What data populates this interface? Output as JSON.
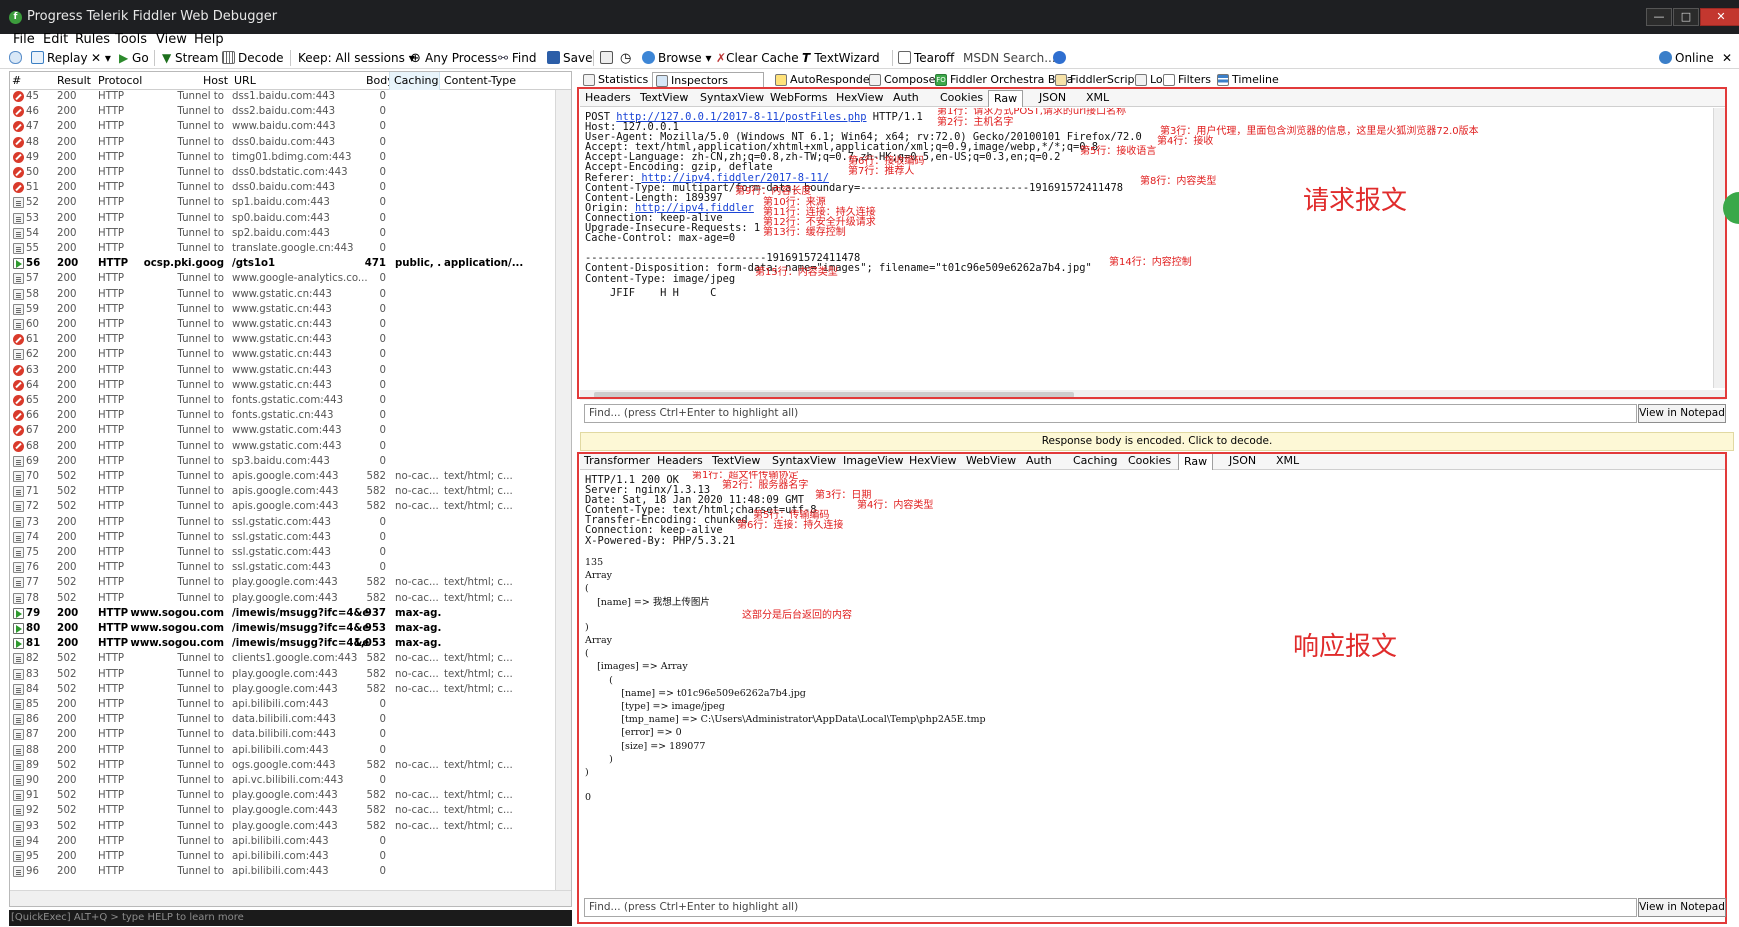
{
  "window": {
    "title": "Progress Telerik Fiddler Web Debugger",
    "controls": {
      "minimize": "—",
      "maximize": "□",
      "close": "✕"
    }
  },
  "menu": [
    "File",
    "Edit",
    "Rules",
    "Tools",
    "View",
    "Help"
  ],
  "toolbar": {
    "replay": "Replay",
    "remove": "✕ ▾",
    "go": "Go",
    "stream": "Stream",
    "decode": "Decode",
    "keep": "Keep: All sessions ▾",
    "any_process": "Any Process",
    "find": "Find",
    "save": "Save",
    "browse": "Browse ▾",
    "clear_cache": "Clear Cache",
    "textwizard": "TextWizard",
    "tearoff": "Tearoff",
    "msdn_search": "MSDN Search...",
    "online": "Online"
  },
  "sessions": {
    "columns": [
      "#",
      "Result",
      "Protocol",
      "Host",
      "URL",
      "Body",
      "Caching",
      "Content-Type"
    ],
    "rows": [
      {
        "id": "45",
        "icon": "blocked",
        "result": "200",
        "protocol": "HTTP",
        "host": "Tunnel to",
        "url": "dss1.baidu.com:443",
        "body": "0",
        "caching": "",
        "ctype": ""
      },
      {
        "id": "46",
        "icon": "blocked",
        "result": "200",
        "protocol": "HTTP",
        "host": "Tunnel to",
        "url": "dss2.baidu.com:443",
        "body": "0",
        "caching": "",
        "ctype": ""
      },
      {
        "id": "47",
        "icon": "blocked",
        "result": "200",
        "protocol": "HTTP",
        "host": "Tunnel to",
        "url": "www.baidu.com:443",
        "body": "0",
        "caching": "",
        "ctype": ""
      },
      {
        "id": "48",
        "icon": "blocked",
        "result": "200",
        "protocol": "HTTP",
        "host": "Tunnel to",
        "url": "dss0.baidu.com:443",
        "body": "0",
        "caching": "",
        "ctype": ""
      },
      {
        "id": "49",
        "icon": "blocked",
        "result": "200",
        "protocol": "HTTP",
        "host": "Tunnel to",
        "url": "timg01.bdimg.com:443",
        "body": "0",
        "caching": "",
        "ctype": ""
      },
      {
        "id": "50",
        "icon": "blocked",
        "result": "200",
        "protocol": "HTTP",
        "host": "Tunnel to",
        "url": "dss0.bdstatic.com:443",
        "body": "0",
        "caching": "",
        "ctype": ""
      },
      {
        "id": "51",
        "icon": "blocked",
        "result": "200",
        "protocol": "HTTP",
        "host": "Tunnel to",
        "url": "dss0.baidu.com:443",
        "body": "0",
        "caching": "",
        "ctype": ""
      },
      {
        "id": "52",
        "icon": "tunnel",
        "result": "200",
        "protocol": "HTTP",
        "host": "Tunnel to",
        "url": "sp1.baidu.com:443",
        "body": "0",
        "caching": "",
        "ctype": ""
      },
      {
        "id": "53",
        "icon": "tunnel",
        "result": "200",
        "protocol": "HTTP",
        "host": "Tunnel to",
        "url": "sp0.baidu.com:443",
        "body": "0",
        "caching": "",
        "ctype": ""
      },
      {
        "id": "54",
        "icon": "tunnel",
        "result": "200",
        "protocol": "HTTP",
        "host": "Tunnel to",
        "url": "sp2.baidu.com:443",
        "body": "0",
        "caching": "",
        "ctype": ""
      },
      {
        "id": "55",
        "icon": "tunnel",
        "result": "200",
        "protocol": "HTTP",
        "host": "Tunnel to",
        "url": "translate.google.cn:443",
        "body": "0",
        "caching": "",
        "ctype": ""
      },
      {
        "id": "56",
        "icon": "arrow",
        "bold": true,
        "result": "200",
        "protocol": "HTTP",
        "host": "ocsp.pki.goog",
        "url": "/gts1o1",
        "body": "471",
        "caching": "public, ...",
        "ctype": "application/..."
      },
      {
        "id": "57",
        "icon": "tunnel",
        "result": "200",
        "protocol": "HTTP",
        "host": "Tunnel to",
        "url": "www.google-analytics.co...",
        "body": "0",
        "caching": "",
        "ctype": ""
      },
      {
        "id": "58",
        "icon": "tunnel",
        "result": "200",
        "protocol": "HTTP",
        "host": "Tunnel to",
        "url": "www.gstatic.cn:443",
        "body": "0",
        "caching": "",
        "ctype": ""
      },
      {
        "id": "59",
        "icon": "tunnel",
        "result": "200",
        "protocol": "HTTP",
        "host": "Tunnel to",
        "url": "www.gstatic.cn:443",
        "body": "0",
        "caching": "",
        "ctype": ""
      },
      {
        "id": "60",
        "icon": "tunnel",
        "result": "200",
        "protocol": "HTTP",
        "host": "Tunnel to",
        "url": "www.gstatic.cn:443",
        "body": "0",
        "caching": "",
        "ctype": ""
      },
      {
        "id": "61",
        "icon": "blocked",
        "result": "200",
        "protocol": "HTTP",
        "host": "Tunnel to",
        "url": "www.gstatic.cn:443",
        "body": "0",
        "caching": "",
        "ctype": ""
      },
      {
        "id": "62",
        "icon": "tunnel",
        "result": "200",
        "protocol": "HTTP",
        "host": "Tunnel to",
        "url": "www.gstatic.cn:443",
        "body": "0",
        "caching": "",
        "ctype": ""
      },
      {
        "id": "63",
        "icon": "blocked",
        "result": "200",
        "protocol": "HTTP",
        "host": "Tunnel to",
        "url": "www.gstatic.cn:443",
        "body": "0",
        "caching": "",
        "ctype": ""
      },
      {
        "id": "64",
        "icon": "blocked",
        "result": "200",
        "protocol": "HTTP",
        "host": "Tunnel to",
        "url": "www.gstatic.cn:443",
        "body": "0",
        "caching": "",
        "ctype": ""
      },
      {
        "id": "65",
        "icon": "blocked",
        "result": "200",
        "protocol": "HTTP",
        "host": "Tunnel to",
        "url": "fonts.gstatic.com:443",
        "body": "0",
        "caching": "",
        "ctype": ""
      },
      {
        "id": "66",
        "icon": "blocked",
        "result": "200",
        "protocol": "HTTP",
        "host": "Tunnel to",
        "url": "fonts.gstatic.cn:443",
        "body": "0",
        "caching": "",
        "ctype": ""
      },
      {
        "id": "67",
        "icon": "blocked",
        "result": "200",
        "protocol": "HTTP",
        "host": "Tunnel to",
        "url": "www.gstatic.com:443",
        "body": "0",
        "caching": "",
        "ctype": ""
      },
      {
        "id": "68",
        "icon": "blocked",
        "result": "200",
        "protocol": "HTTP",
        "host": "Tunnel to",
        "url": "www.gstatic.com:443",
        "body": "0",
        "caching": "",
        "ctype": ""
      },
      {
        "id": "69",
        "icon": "tunnel",
        "result": "200",
        "protocol": "HTTP",
        "host": "Tunnel to",
        "url": "sp3.baidu.com:443",
        "body": "0",
        "caching": "",
        "ctype": ""
      },
      {
        "id": "70",
        "icon": "tunnel",
        "result": "502",
        "protocol": "HTTP",
        "host": "Tunnel to",
        "url": "apis.google.com:443",
        "body": "582",
        "caching": "no-cac...",
        "ctype": "text/html; c..."
      },
      {
        "id": "71",
        "icon": "tunnel",
        "result": "502",
        "protocol": "HTTP",
        "host": "Tunnel to",
        "url": "apis.google.com:443",
        "body": "582",
        "caching": "no-cac...",
        "ctype": "text/html; c..."
      },
      {
        "id": "72",
        "icon": "tunnel",
        "result": "502",
        "protocol": "HTTP",
        "host": "Tunnel to",
        "url": "apis.google.com:443",
        "body": "582",
        "caching": "no-cac...",
        "ctype": "text/html; c..."
      },
      {
        "id": "73",
        "icon": "tunnel",
        "result": "200",
        "protocol": "HTTP",
        "host": "Tunnel to",
        "url": "ssl.gstatic.com:443",
        "body": "0",
        "caching": "",
        "ctype": ""
      },
      {
        "id": "74",
        "icon": "tunnel",
        "result": "200",
        "protocol": "HTTP",
        "host": "Tunnel to",
        "url": "ssl.gstatic.com:443",
        "body": "0",
        "caching": "",
        "ctype": ""
      },
      {
        "id": "75",
        "icon": "tunnel",
        "result": "200",
        "protocol": "HTTP",
        "host": "Tunnel to",
        "url": "ssl.gstatic.com:443",
        "body": "0",
        "caching": "",
        "ctype": ""
      },
      {
        "id": "76",
        "icon": "tunnel",
        "result": "200",
        "protocol": "HTTP",
        "host": "Tunnel to",
        "url": "ssl.gstatic.com:443",
        "body": "0",
        "caching": "",
        "ctype": ""
      },
      {
        "id": "77",
        "icon": "tunnel",
        "result": "502",
        "protocol": "HTTP",
        "host": "Tunnel to",
        "url": "play.google.com:443",
        "body": "582",
        "caching": "no-cac...",
        "ctype": "text/html; c..."
      },
      {
        "id": "78",
        "icon": "tunnel",
        "result": "502",
        "protocol": "HTTP",
        "host": "Tunnel to",
        "url": "play.google.com:443",
        "body": "582",
        "caching": "no-cac...",
        "ctype": "text/html; c..."
      },
      {
        "id": "79",
        "icon": "arrow",
        "bold": true,
        "result": "200",
        "protocol": "HTTP",
        "host": "www.sogou.com",
        "url": "/imewis/msugg?ifc=4&em=4",
        "body": "937",
        "caching": "max-ag...",
        "ctype": ""
      },
      {
        "id": "80",
        "icon": "arrow",
        "bold": true,
        "result": "200",
        "protocol": "HTTP",
        "host": "www.sogou.com",
        "url": "/imewis/msugg?ifc=4&em=4",
        "body": "953",
        "caching": "max-ag...",
        "ctype": ""
      },
      {
        "id": "81",
        "icon": "arrow",
        "bold": true,
        "result": "200",
        "protocol": "HTTP",
        "host": "www.sogou.com",
        "url": "/imewis/msugg?ifc=4&em=4",
        "body": "1,053",
        "caching": "max-ag...",
        "ctype": ""
      },
      {
        "id": "82",
        "icon": "tunnel",
        "result": "502",
        "protocol": "HTTP",
        "host": "Tunnel to",
        "url": "clients1.google.com:443",
        "body": "582",
        "caching": "no-cac...",
        "ctype": "text/html; c..."
      },
      {
        "id": "83",
        "icon": "tunnel",
        "result": "502",
        "protocol": "HTTP",
        "host": "Tunnel to",
        "url": "play.google.com:443",
        "body": "582",
        "caching": "no-cac...",
        "ctype": "text/html; c..."
      },
      {
        "id": "84",
        "icon": "tunnel",
        "result": "502",
        "protocol": "HTTP",
        "host": "Tunnel to",
        "url": "play.google.com:443",
        "body": "582",
        "caching": "no-cac...",
        "ctype": "text/html; c..."
      },
      {
        "id": "85",
        "icon": "tunnel",
        "result": "200",
        "protocol": "HTTP",
        "host": "Tunnel to",
        "url": "api.bilibili.com:443",
        "body": "0",
        "caching": "",
        "ctype": ""
      },
      {
        "id": "86",
        "icon": "tunnel",
        "result": "200",
        "protocol": "HTTP",
        "host": "Tunnel to",
        "url": "data.bilibili.com:443",
        "body": "0",
        "caching": "",
        "ctype": ""
      },
      {
        "id": "87",
        "icon": "tunnel",
        "result": "200",
        "protocol": "HTTP",
        "host": "Tunnel to",
        "url": "data.bilibili.com:443",
        "body": "0",
        "caching": "",
        "ctype": ""
      },
      {
        "id": "88",
        "icon": "tunnel",
        "result": "200",
        "protocol": "HTTP",
        "host": "Tunnel to",
        "url": "api.bilibili.com:443",
        "body": "0",
        "caching": "",
        "ctype": ""
      },
      {
        "id": "89",
        "icon": "tunnel",
        "result": "502",
        "protocol": "HTTP",
        "host": "Tunnel to",
        "url": "ogs.google.com:443",
        "body": "582",
        "caching": "no-cac...",
        "ctype": "text/html; c..."
      },
      {
        "id": "90",
        "icon": "tunnel",
        "result": "200",
        "protocol": "HTTP",
        "host": "Tunnel to",
        "url": "api.vc.bilibili.com:443",
        "body": "0",
        "caching": "",
        "ctype": ""
      },
      {
        "id": "91",
        "icon": "tunnel",
        "result": "502",
        "protocol": "HTTP",
        "host": "Tunnel to",
        "url": "play.google.com:443",
        "body": "582",
        "caching": "no-cac...",
        "ctype": "text/html; c..."
      },
      {
        "id": "92",
        "icon": "tunnel",
        "result": "502",
        "protocol": "HTTP",
        "host": "Tunnel to",
        "url": "play.google.com:443",
        "body": "582",
        "caching": "no-cac...",
        "ctype": "text/html; c..."
      },
      {
        "id": "93",
        "icon": "tunnel",
        "result": "502",
        "protocol": "HTTP",
        "host": "Tunnel to",
        "url": "play.google.com:443",
        "body": "582",
        "caching": "no-cac...",
        "ctype": "text/html; c..."
      },
      {
        "id": "94",
        "icon": "tunnel",
        "result": "200",
        "protocol": "HTTP",
        "host": "Tunnel to",
        "url": "api.bilibili.com:443",
        "body": "0",
        "caching": "",
        "ctype": ""
      },
      {
        "id": "95",
        "icon": "tunnel",
        "result": "200",
        "protocol": "HTTP",
        "host": "Tunnel to",
        "url": "api.bilibili.com:443",
        "body": "0",
        "caching": "",
        "ctype": ""
      },
      {
        "id": "96",
        "icon": "tunnel",
        "result": "200",
        "protocol": "HTTP",
        "host": "Tunnel to",
        "url": "api.bilibili.com:443",
        "body": "0",
        "caching": "",
        "ctype": ""
      }
    ]
  },
  "quickexec": "[QuickExec] ALT+Q > type HELP to learn more",
  "main_tabs": [
    "Statistics",
    "Inspectors",
    "AutoResponder",
    "Composer",
    "Fiddler Orchestra Beta",
    "FiddlerScript",
    "Log",
    "Filters",
    "Timeline"
  ],
  "fo_badge": "FO",
  "request": {
    "tabs": [
      "Headers",
      "TextView",
      "SyntaxView",
      "WebForms",
      "HexView",
      "Auth",
      "Cookies",
      "Raw",
      "JSON",
      "XML"
    ],
    "selected_tab": "Raw",
    "lines": [
      {
        "pre": "POST ",
        "link": "http://127.0.0.1/2017-8-11/postFiles.php",
        "post": " HTTP/1.1"
      },
      {
        "pre": "Host: 127.0.0.1"
      },
      {
        "pre": "User-Agent: Mozilla/5.0 (Windows NT 6.1; Win64; x64; rv:72.0) Gecko/20100101 Firefox/72.0"
      },
      {
        "pre": "Accept: text/html,application/xhtml+xml,application/xml;q=0.9,image/webp,*/*;q=0.8"
      },
      {
        "pre": "Accept-Language: zh-CN,zh;q=0.8,zh-TW;q=0.7,zh-HK;q=0.5,en-US;q=0.3,en;q=0.2"
      },
      {
        "pre": "Accept-Encoding: gzip, deflate"
      },
      {
        "pre": "Referer: ",
        "link": "http://ipv4.fiddler/2017-8-11/"
      },
      {
        "pre": "Content-Type: multipart/form-data; boundary=---------------------------191691572411478"
      },
      {
        "pre": "Content-Length: 189397"
      },
      {
        "pre": "Origin: ",
        "link": "http://ipv4.fiddler"
      },
      {
        "pre": "Connection: keep-alive"
      },
      {
        "pre": "Upgrade-Insecure-Requests: 1"
      },
      {
        "pre": "Cache-Control: max-age=0"
      },
      {
        "pre": ""
      },
      {
        "pre": "-----------------------------191691572411478"
      },
      {
        "pre": "Content-Disposition: form-data; name=\"images\"; filename=\"t01c96e509e6262a7b4.jpg\""
      },
      {
        "pre": "Content-Type: image/jpeg"
      },
      {
        "pre": ""
      },
      {
        "pre": "    JFIF    H H     C"
      }
    ],
    "notes": [
      "第1行：请求方式POST,请求的url接口名称",
      "第2行：主机名字",
      "第3行：用户代理，里面包含浏览器的信息，这里是火狐浏览器72.0版本",
      "第4行：接收",
      "第5行：接收语言",
      "第6行：接收编码",
      "第7行：推荐人",
      "第8行：内容类型",
      "第9行：内容长度",
      "第10行：来源",
      "第11行：连接：持久连接",
      "第12行：不安全升级请求",
      "第13行：缓存控制",
      "第14行：内容控制",
      "第15行：内容类型"
    ],
    "label": "请求报文",
    "find_placeholder": "Find... (press Ctrl+Enter to highlight all)",
    "notepad": "View in Notepad"
  },
  "encoded_bar": "Response body is encoded. Click to decode.",
  "response": {
    "tabs": [
      "Transformer",
      "Headers",
      "TextView",
      "SyntaxView",
      "ImageView",
      "HexView",
      "WebView",
      "Auth",
      "Caching",
      "Cookies",
      "Raw",
      "JSON",
      "XML"
    ],
    "selected_tab": "Raw",
    "header_lines": [
      "HTTP/1.1 200 OK",
      "Server: nginx/1.3.13",
      "Date: Sat, 18 Jan 2020 11:48:09 GMT",
      "Content-Type: text/html;charset=utf-8",
      "Transfer-Encoding: chunked",
      "Connection: keep-alive",
      "X-Powered-By: PHP/5.3.21"
    ],
    "header_notes": [
      "第1行：超文件传输协定",
      "第2行：服务器名字",
      "第3行：日期",
      "第4行：内容类型",
      "第5行：传输编码",
      "第6行：连接：持久连接"
    ],
    "body_lines": [
      "135",
      "Array",
      "(",
      "    [name] => 我想上传图片",
      ")",
      "Array",
      "(",
      "    [images] => Array",
      "        (",
      "            [name] => t01c96e509e6262a7b4.jpg",
      "            [type] => image/jpeg",
      "            [tmp_name] => C:\\Users\\Administrator\\AppData\\Local\\Temp\\php2A5E.tmp",
      "            [error] => 0",
      "            [size] => 189077",
      "        )",
      ")",
      "0"
    ],
    "body_note": "这部分是后台返回的内容",
    "label": "响应报文",
    "find_placeholder": "Find... (press Ctrl+Enter to highlight all)",
    "notepad": "View in Notepad"
  }
}
